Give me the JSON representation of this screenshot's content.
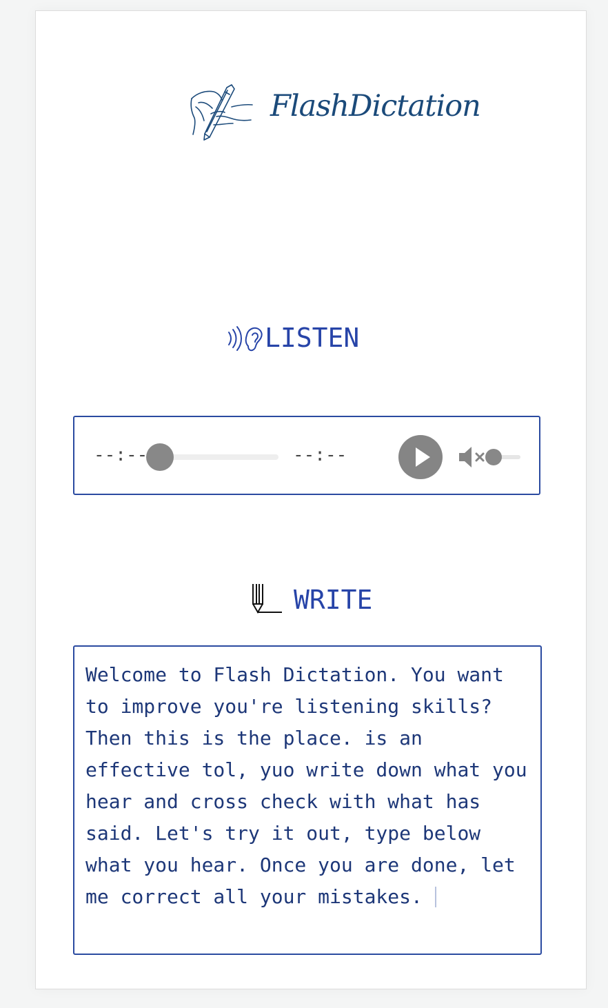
{
  "app": {
    "brand_name": "FlashDictation",
    "logo_icon": "hand-writing-pencil-icon"
  },
  "listen": {
    "title": "LISTEN",
    "icon": "ear-icon"
  },
  "player": {
    "current_time": "--:--",
    "total_time": "--:--",
    "progress": 0,
    "volume": 0,
    "muted": true,
    "play_icon": "play-icon",
    "mute_icon": "volume-muted-icon"
  },
  "write": {
    "title": "WRITE",
    "icon": "pen-writing-icon",
    "text": "Welcome to Flash Dictation. You want to improve you're listening skills? Then this is the place. is an effective tol, yuo write down what you hear and cross check with what has said. Let's try it out, type below what you hear. Once you are done, let me correct all your mistakes."
  },
  "colors": {
    "accent": "#2744a8",
    "border": "#2a4aa0",
    "text": "#1d3778",
    "control_gray": "#858585"
  }
}
